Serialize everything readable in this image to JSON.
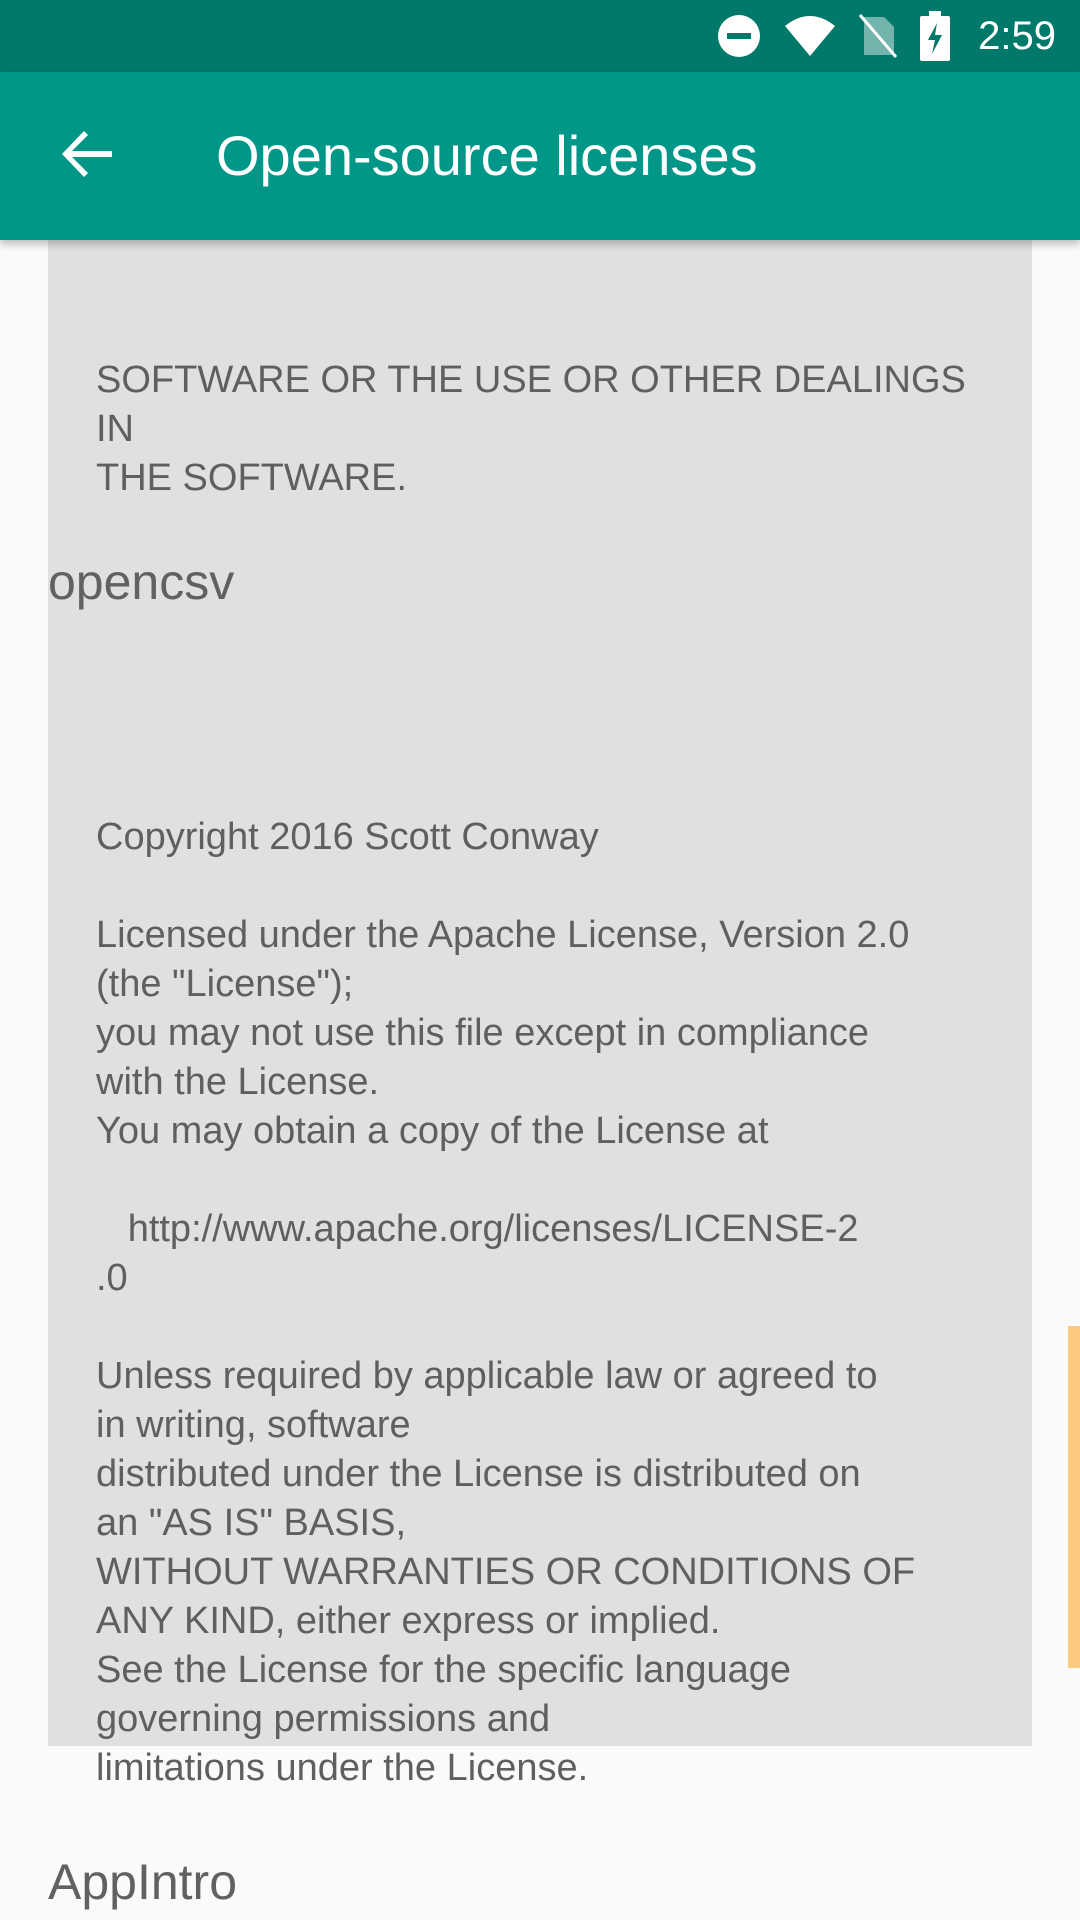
{
  "status_bar": {
    "time": "2:59",
    "icons": [
      "do-not-disturb-icon",
      "wifi-icon",
      "no-sim-icon",
      "battery-charging-icon"
    ]
  },
  "app_bar": {
    "back_icon": "arrow-back-icon",
    "title": "Open-source licenses"
  },
  "licenses": [
    {
      "text": "SOFTWARE OR THE USE OR OTHER DEALINGS\nIN\nTHE SOFTWARE."
    },
    {
      "name": "opencsv",
      "text": "Copyright 2016 Scott Conway\n\nLicensed under the Apache License, Version 2.0\n(the \"License\");\nyou may not use this file except in compliance\nwith the License.\nYou may obtain a copy of the License at\n\n   http://www.apache.org/licenses/LICENSE-2\n.0\n\nUnless required by applicable law or agreed to\nin writing, software\ndistributed under the License is distributed on\nan \"AS IS\" BASIS,\nWITHOUT WARRANTIES OR CONDITIONS OF\nANY KIND, either express or implied.\nSee the License for the specific language\ngoverning permissions and\nlimitations under the License."
    },
    {
      "name": "AppIntro"
    }
  ],
  "colors": {
    "status_bar": "#00796b",
    "app_bar": "#009688",
    "license_box": "#e0e0e0",
    "scrollbar": "#fbc97f"
  }
}
